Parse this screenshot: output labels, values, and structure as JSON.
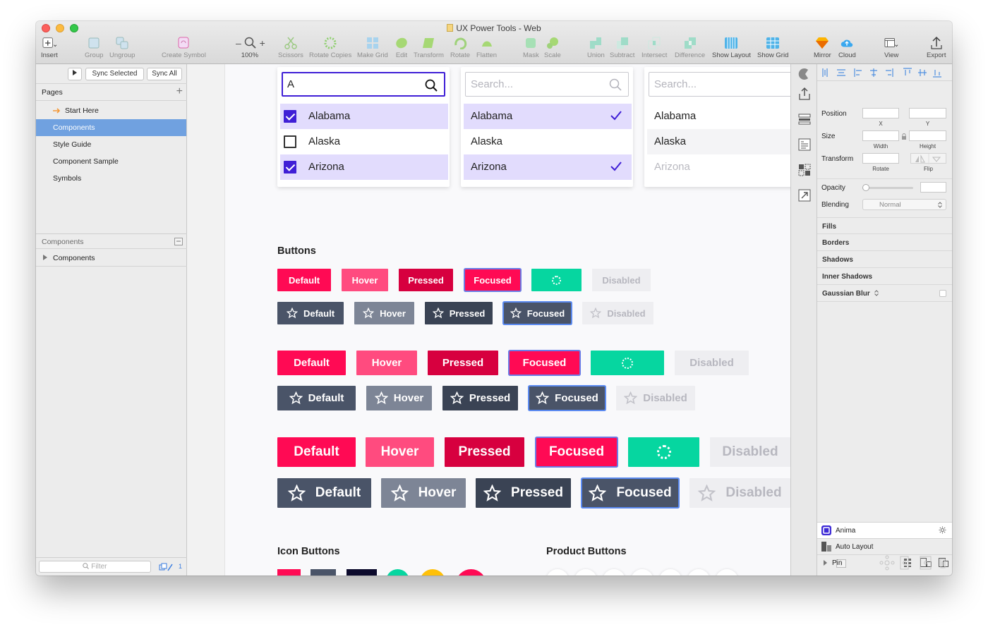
{
  "window": {
    "title": "UX Power Tools - Web"
  },
  "toolbar": {
    "insert": "Insert",
    "group": "Group",
    "ungroup": "Ungroup",
    "create_symbol": "Create Symbol",
    "zoom_minus": "–",
    "zoom_plus": "+",
    "zoom": "100%",
    "scissors": "Scissors",
    "rotate_copies": "Rotate Copies",
    "make_grid": "Make Grid",
    "edit": "Edit",
    "transform": "Transform",
    "rotate": "Rotate",
    "flatten": "Flatten",
    "mask": "Mask",
    "scale": "Scale",
    "union": "Union",
    "subtract": "Subtract",
    "intersect": "Intersect",
    "difference": "Difference",
    "show_layout": "Show Layout",
    "show_grid": "Show Grid",
    "mirror": "Mirror",
    "cloud": "Cloud",
    "view": "View",
    "export": "Export"
  },
  "sidebar": {
    "sync_selected": "Sync Selected",
    "sync_all": "Sync All",
    "pages_label": "Pages",
    "pages": [
      "Start Here",
      "Components",
      "Style Guide",
      "Component Sample",
      "Symbols"
    ],
    "selected_page": "Components",
    "components_header": "Components",
    "components_item": "Components",
    "filter_placeholder": "Filter",
    "count": "1"
  },
  "dropdowns": {
    "first": {
      "query": "A",
      "options": [
        "Alabama",
        "Alaska",
        "Arizona"
      ]
    },
    "second": {
      "placeholder": "Search...",
      "options": [
        "Alabama",
        "Alaska",
        "Arizona"
      ]
    },
    "third": {
      "placeholder": "Search...",
      "options": [
        "Alabama",
        "Alaska",
        "Arizona"
      ]
    }
  },
  "buttons": {
    "title": "Buttons",
    "default": "Default",
    "hover": "Hover",
    "pressed": "Pressed",
    "focused": "Focused",
    "disabled": "Disabled"
  },
  "icon_buttons": {
    "title": "Icon Buttons"
  },
  "product_buttons": {
    "title": "Product Buttons",
    "icons": [
      "facebook-icon",
      "youtube-icon",
      "instagram-icon",
      "paypal-icon",
      "shopify-icon",
      "ux-power-tools-icon",
      "twitter-icon"
    ]
  },
  "inspector": {
    "position": "Position",
    "x": "X",
    "y": "Y",
    "size": "Size",
    "width": "Width",
    "height": "Height",
    "transform": "Transform",
    "rotate": "Rotate",
    "flip": "Flip",
    "opacity": "Opacity",
    "blending": "Blending",
    "blending_value": "Normal",
    "fills": "Fills",
    "borders": "Borders",
    "shadows": "Shadows",
    "inner_shadows": "Inner Shadows",
    "gaussian_blur": "Gaussian Blur",
    "anima": "Anima",
    "auto_layout": "Auto Layout",
    "pin": "Pin"
  },
  "colors": {
    "accent_purple": "#3f1fd6",
    "pink": "#ff0a54",
    "teal": "#06d6a0",
    "slate": "#4a5468",
    "yellow": "#ffc008"
  }
}
